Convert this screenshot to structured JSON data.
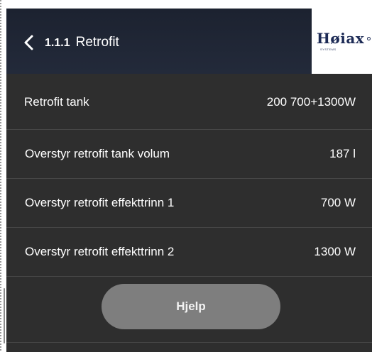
{
  "header": {
    "number": "1.1.1",
    "title": "Retrofit"
  },
  "logo": {
    "text": "Høiax",
    "subtext": "SYSTEMS"
  },
  "rows": [
    {
      "label": "Retrofit tank",
      "value": "200 700+1300W"
    },
    {
      "label": "Overstyr retrofit tank volum",
      "value": "187 l"
    },
    {
      "label": "Overstyr retrofit effekttrinn 1",
      "value": "700 W"
    },
    {
      "label": "Overstyr retrofit effekttrinn 2",
      "value": "1300 W"
    }
  ],
  "help_button": {
    "label": "Hjelp"
  }
}
